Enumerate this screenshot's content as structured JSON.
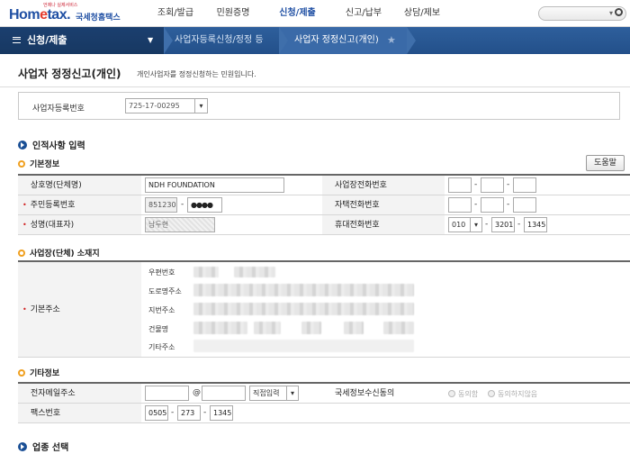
{
  "header": {
    "logo_tagline": "언제나 실제서비스",
    "logo_brand_a": "Hom",
    "logo_brand_e": "e",
    "logo_brand_b": "tax.",
    "logo_brand_kr": "국세청홈택스",
    "nav": [
      {
        "label": "조회/발급",
        "active": false
      },
      {
        "label": "민원증명",
        "active": false
      },
      {
        "label": "신청/제출",
        "active": true
      },
      {
        "label": "신고/납부",
        "active": false
      },
      {
        "label": "상담/제보",
        "active": false
      }
    ]
  },
  "breadcrumb": {
    "menu_label": "신청/제출",
    "item1": "사업자등록신청/정정 등",
    "item2": "사업자 정정신고(개인)"
  },
  "page": {
    "title": "사업자 정정신고(개인)",
    "desc": "개인사업자를 정정신청하는 민원입니다."
  },
  "reg": {
    "label": "사업자등록번호",
    "value": "725-17-00295"
  },
  "sections": {
    "personal": "인적사항 입력",
    "basic": "기본정보",
    "location": "사업장(단체) 소재지",
    "other": "기타정보",
    "industry": "업종 선택"
  },
  "help_label": "도움말",
  "basic": {
    "company_label": "상호명(단체명)",
    "company_value": "NDH FOUNDATION",
    "biz_phone_label": "사업장전화번호",
    "rrn_label": "주민등록번호",
    "rrn_front": "851230",
    "rrn_back": "●●●●",
    "home_phone_label": "자택전화번호",
    "name_label": "성명(대표자)",
    "name_value": "남두현",
    "mobile_label": "휴대전화번호",
    "mobile_1": "010",
    "mobile_2": "3201",
    "mobile_3": "1345"
  },
  "address": {
    "label": "기본주소",
    "zip": "우편번호",
    "road": "도로명주소",
    "lot": "지번주소",
    "building": "건물명",
    "other": "기타주소"
  },
  "other": {
    "email_label": "전자메일주소",
    "at": "@",
    "email_select": "직접입력",
    "consent_label": "국세정보수신동의",
    "consent_yes": "동의함",
    "consent_no": "동의하지않음",
    "fax_label": "팩스번호",
    "fax_1": "0505",
    "fax_2": "273",
    "fax_3": "1345"
  }
}
